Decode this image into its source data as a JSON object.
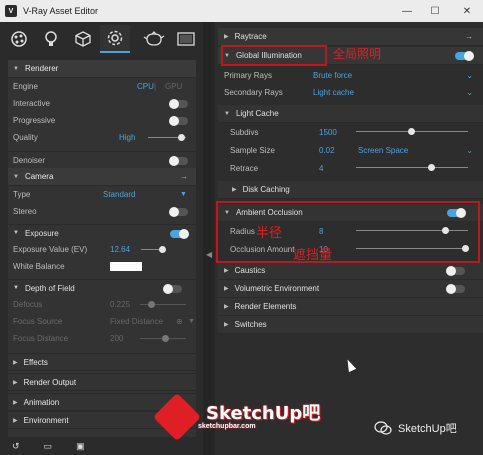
{
  "window": {
    "title": "V-Ray Asset Editor",
    "controls": [
      "—",
      "☐",
      "✕"
    ]
  },
  "toolbar": {
    "icons": [
      "materials-icon",
      "lights-icon",
      "geometry-icon",
      "settings-icon",
      "render-teapot-icon",
      "frame-buffer-icon"
    ]
  },
  "left": {
    "renderer": {
      "title": "Renderer",
      "engine_label": "Engine",
      "engine_cpu": "CPU",
      "engine_sep": "|",
      "engine_gpu": "GPU",
      "interactive_label": "Interactive",
      "progressive_label": "Progressive",
      "quality_label": "Quality",
      "quality_value": "High",
      "denoiser_label": "Denoiser"
    },
    "camera": {
      "title": "Camera",
      "type_label": "Type",
      "type_value": "Standard",
      "stereo_label": "Stereo"
    },
    "exposure": {
      "title": "Exposure",
      "ev_label": "Exposure Value (EV)",
      "ev_value": "12.64",
      "wb_label": "White Balance"
    },
    "dof": {
      "title": "Depth of Field",
      "defocus_label": "Defocus",
      "defocus_value": "0.225",
      "focus_source_label": "Focus Source",
      "focus_source_value": "Fixed Distance",
      "focus_distance_label": "Focus Distance",
      "focus_distance_value": "200"
    },
    "collapsed": [
      "Effects",
      "Render Output",
      "Animation",
      "Environment"
    ]
  },
  "right": {
    "raytrace": "Raytrace",
    "gi": {
      "title": "Global Illumination",
      "primary_label": "Primary Rays",
      "primary_value": "Brute force",
      "secondary_label": "Secondary Rays",
      "secondary_value": "Light cache"
    },
    "light_cache": {
      "title": "Light Cache",
      "subdivs_label": "Subdivs",
      "subdivs_value": "1500",
      "sample_label": "Sample Size",
      "sample_value": "0.02",
      "sample_mode": "Screen Space",
      "retrace_label": "Retrace",
      "retrace_value": "4"
    },
    "disk_caching": "Disk Caching",
    "ao": {
      "title": "Ambient Occlusion",
      "radius_label": "Radius",
      "radius_value": "8",
      "amount_label": "Occlusion Amount",
      "amount_value": "10"
    },
    "collapsed": [
      "Caustics",
      "Volumetric Environment",
      "Render Elements",
      "Switches"
    ]
  },
  "annotations": {
    "gi": "全局照明",
    "radius": "半径",
    "amount": "遮挡量"
  },
  "watermark": {
    "brand": "SketchUp吧",
    "site": "sketchupbar.com",
    "wechat": "SketchUp吧"
  },
  "colors": {
    "accent": "#4aa3df",
    "annotation": "#e02020",
    "panel": "#333333"
  }
}
